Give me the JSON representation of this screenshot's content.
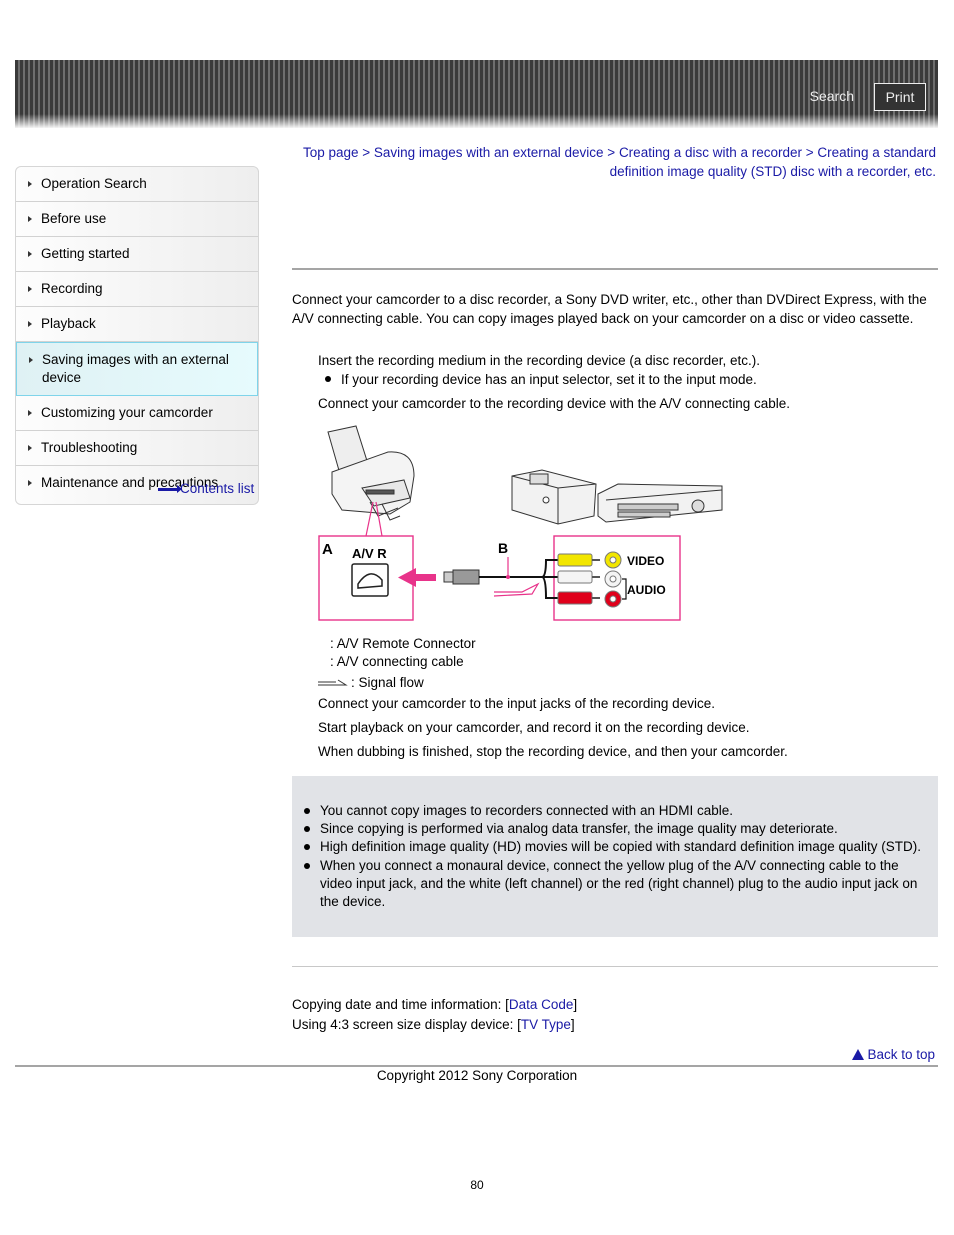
{
  "header": {
    "search_label": "Search",
    "print_label": "Print"
  },
  "sidebar": {
    "items": [
      {
        "label": "Operation Search"
      },
      {
        "label": "Before use"
      },
      {
        "label": "Getting started"
      },
      {
        "label": "Recording"
      },
      {
        "label": "Playback"
      },
      {
        "label": "Saving images with an external device",
        "active": true
      },
      {
        "label": "Customizing your camcorder"
      },
      {
        "label": "Troubleshooting"
      },
      {
        "label": "Maintenance and precautions"
      }
    ],
    "contents_link": "Contents list"
  },
  "breadcrumb": {
    "items": [
      "Top page",
      "Saving images with an external device",
      "Creating a disc with a recorder",
      "Creating a standard definition image quality (STD) disc with a recorder, etc."
    ],
    "separator": " > "
  },
  "main": {
    "intro": "Connect your camcorder to a disc recorder, a Sony DVD writer, etc., other than DVDirect Express, with the A/V connecting cable. You can copy images played back on your camcorder on a disc or video cassette.",
    "step1": "Insert the recording medium in the recording device (a disc recorder, etc.).",
    "step1_bullet": "If your recording device has an input selector, set it to the input mode.",
    "step2": "Connect your camcorder to the recording device with the A/V connecting cable.",
    "diagram": {
      "label_a": "A",
      "label_b": "B",
      "port_label": "A/V R",
      "video_label": "VIDEO",
      "audio_label": "AUDIO",
      "colors": {
        "accent": "#e8338a",
        "yellow": "#f2e600",
        "red": "#e0001b",
        "white": "#eeeeee"
      }
    },
    "legend_a": ": A/V Remote Connector",
    "legend_b": ": A/V connecting cable",
    "legend_signal": ": Signal flow",
    "step3": "Connect your camcorder to the input jacks of the recording device.",
    "step4": "Start playback on your camcorder, and record it on the recording device.",
    "step5": "When dubbing is finished, stop the recording device, and then your camcorder."
  },
  "notes": [
    "You cannot copy images to recorders connected with an HDMI cable.",
    "Since copying is performed via analog data transfer, the image quality may deteriorate.",
    "High definition image quality (HD) movies will be copied with standard definition image quality (STD).",
    "When you connect a monaural device, connect the yellow plug of the A/V connecting cable to the video input jack, and the white (left channel) or the red (right channel) plug to the audio input jack on the device."
  ],
  "related": [
    {
      "prefix": "Copying date and time information: [",
      "link": "Data Code",
      "suffix": "]"
    },
    {
      "prefix": "Using 4:3 screen size display device: [",
      "link": "TV Type",
      "suffix": "]"
    }
  ],
  "footer": {
    "back_to_top": "Back to top",
    "copyright": "Copyright 2012 Sony Corporation",
    "page_number": "80"
  }
}
